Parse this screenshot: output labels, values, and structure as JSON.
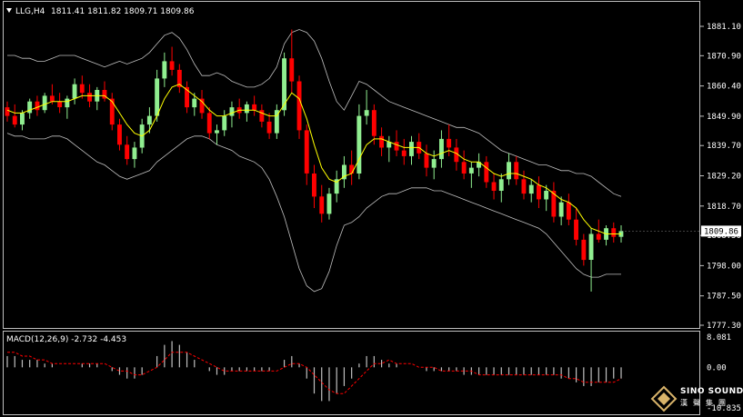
{
  "header": {
    "symbol": "LLG,H4",
    "ohlc": "1811.41 1811.82 1809.71 1809.86"
  },
  "macd_header": "MACD(12,26,9) -2.732 -4.453",
  "colors": {
    "background": "#000000",
    "bull": "#90ee90",
    "bear": "#ff0000",
    "ma": "#ffff00",
    "bands": "#c0c0c0",
    "signal": "#ff0000",
    "hist": "#c0c0c0"
  },
  "watermark": {
    "name": "SINO SOUND",
    "sub": "漢聲集團"
  },
  "chart_data": [
    {
      "type": "candlestick",
      "title": "",
      "price_axis": {
        "ticks": [
          "1881.10",
          "1870.90",
          "1860.40",
          "1849.90",
          "1839.70",
          "1829.20",
          "1818.70",
          "1808.50",
          "1798.00",
          "1787.50",
          "1777.30"
        ],
        "range": [
          1777.3,
          1881.1
        ]
      },
      "current_price_label": "1809.86",
      "candles": [
        [
          1853,
          1855,
          1848,
          1850
        ],
        [
          1850,
          1854,
          1846,
          1847
        ],
        [
          1847,
          1852,
          1845,
          1851
        ],
        [
          1851,
          1856,
          1849,
          1855
        ],
        [
          1855,
          1857,
          1850,
          1852
        ],
        [
          1852,
          1858,
          1851,
          1857
        ],
        [
          1857,
          1861,
          1854,
          1855
        ],
        [
          1855,
          1858,
          1851,
          1853
        ],
        [
          1853,
          1857,
          1849,
          1856
        ],
        [
          1856,
          1863,
          1854,
          1861
        ],
        [
          1861,
          1864,
          1856,
          1858
        ],
        [
          1858,
          1861,
          1853,
          1855
        ],
        [
          1855,
          1860,
          1852,
          1859
        ],
        [
          1859,
          1862,
          1855,
          1856
        ],
        [
          1856,
          1858,
          1845,
          1847
        ],
        [
          1847,
          1849,
          1838,
          1840
        ],
        [
          1840,
          1843,
          1833,
          1835
        ],
        [
          1835,
          1841,
          1832,
          1839
        ],
        [
          1839,
          1849,
          1837,
          1847
        ],
        [
          1847,
          1853,
          1844,
          1850
        ],
        [
          1850,
          1866,
          1848,
          1863
        ],
        [
          1863,
          1872,
          1860,
          1869
        ],
        [
          1869,
          1874,
          1864,
          1866
        ],
        [
          1866,
          1868,
          1858,
          1860
        ],
        [
          1860,
          1862,
          1851,
          1853
        ],
        [
          1853,
          1858,
          1850,
          1856
        ],
        [
          1856,
          1859,
          1849,
          1851
        ],
        [
          1851,
          1853,
          1842,
          1844
        ],
        [
          1844,
          1847,
          1840,
          1845
        ],
        [
          1845,
          1852,
          1843,
          1850
        ],
        [
          1850,
          1855,
          1846,
          1853
        ],
        [
          1853,
          1856,
          1849,
          1851
        ],
        [
          1851,
          1855,
          1848,
          1854
        ],
        [
          1854,
          1857,
          1850,
          1852
        ],
        [
          1852,
          1854,
          1846,
          1848
        ],
        [
          1848,
          1851,
          1842,
          1844
        ],
        [
          1844,
          1854,
          1842,
          1852
        ],
        [
          1852,
          1872,
          1850,
          1870
        ],
        [
          1870,
          1880,
          1858,
          1862
        ],
        [
          1862,
          1864,
          1842,
          1845
        ],
        [
          1845,
          1847,
          1826,
          1830
        ],
        [
          1830,
          1833,
          1818,
          1822
        ],
        [
          1822,
          1826,
          1813,
          1816
        ],
        [
          1816,
          1825,
          1814,
          1823
        ],
        [
          1823,
          1831,
          1820,
          1828
        ],
        [
          1828,
          1836,
          1825,
          1833
        ],
        [
          1833,
          1838,
          1826,
          1830
        ],
        [
          1830,
          1854,
          1828,
          1850
        ],
        [
          1850,
          1859,
          1847,
          1852
        ],
        [
          1852,
          1854,
          1840,
          1843
        ],
        [
          1843,
          1846,
          1836,
          1839
        ],
        [
          1839,
          1843,
          1834,
          1841
        ],
        [
          1841,
          1845,
          1836,
          1838
        ],
        [
          1838,
          1842,
          1833,
          1836
        ],
        [
          1836,
          1843,
          1833,
          1841
        ],
        [
          1841,
          1844,
          1835,
          1837
        ],
        [
          1837,
          1840,
          1829,
          1832
        ],
        [
          1832,
          1838,
          1828,
          1835
        ],
        [
          1835,
          1845,
          1832,
          1842
        ],
        [
          1842,
          1847,
          1836,
          1839
        ],
        [
          1839,
          1842,
          1831,
          1834
        ],
        [
          1834,
          1838,
          1828,
          1830
        ],
        [
          1830,
          1834,
          1825,
          1832
        ],
        [
          1832,
          1837,
          1829,
          1834
        ],
        [
          1834,
          1836,
          1825,
          1827
        ],
        [
          1827,
          1830,
          1821,
          1824
        ],
        [
          1824,
          1830,
          1820,
          1828
        ],
        [
          1828,
          1837,
          1826,
          1834
        ],
        [
          1834,
          1836,
          1826,
          1828
        ],
        [
          1828,
          1831,
          1821,
          1823
        ],
        [
          1823,
          1828,
          1820,
          1826
        ],
        [
          1826,
          1829,
          1818,
          1821
        ],
        [
          1821,
          1826,
          1817,
          1824
        ],
        [
          1824,
          1827,
          1813,
          1815
        ],
        [
          1815,
          1822,
          1812,
          1820
        ],
        [
          1820,
          1823,
          1812,
          1814
        ],
        [
          1814,
          1818,
          1805,
          1807
        ],
        [
          1807,
          1809,
          1798,
          1800
        ],
        [
          1800,
          1811,
          1789,
          1809
        ],
        [
          1809,
          1814,
          1806,
          1807
        ],
        [
          1807,
          1812,
          1805,
          1811
        ],
        [
          1811,
          1813,
          1806,
          1808
        ],
        [
          1808,
          1812,
          1806,
          1810
        ]
      ],
      "moving_average": [
        1852,
        1851,
        1851,
        1852,
        1853,
        1854,
        1855,
        1855,
        1855,
        1856,
        1857,
        1857,
        1857,
        1857,
        1855,
        1851,
        1847,
        1844,
        1843,
        1845,
        1850,
        1856,
        1860,
        1861,
        1859,
        1857,
        1855,
        1852,
        1850,
        1850,
        1851,
        1852,
        1852,
        1852,
        1851,
        1850,
        1850,
        1854,
        1858,
        1856,
        1849,
        1840,
        1832,
        1828,
        1827,
        1829,
        1830,
        1835,
        1840,
        1842,
        1842,
        1841,
        1840,
        1839,
        1839,
        1839,
        1837,
        1836,
        1837,
        1838,
        1837,
        1835,
        1834,
        1834,
        1832,
        1830,
        1829,
        1830,
        1830,
        1829,
        1828,
        1826,
        1825,
        1823,
        1821,
        1820,
        1818,
        1814,
        1811,
        1810,
        1809,
        1809,
        1809
      ],
      "bollinger_upper": [
        1871,
        1871,
        1870,
        1870,
        1869,
        1869,
        1870,
        1871,
        1871,
        1871,
        1870,
        1869,
        1868,
        1867,
        1868,
        1869,
        1868,
        1869,
        1870,
        1872,
        1875,
        1878,
        1879,
        1877,
        1873,
        1868,
        1864,
        1864,
        1865,
        1864,
        1862,
        1861,
        1860,
        1860,
        1861,
        1863,
        1867,
        1875,
        1879,
        1880,
        1879,
        1876,
        1870,
        1862,
        1855,
        1852,
        1857,
        1862,
        1861,
        1859,
        1857,
        1855,
        1854,
        1853,
        1852,
        1851,
        1850,
        1849,
        1848,
        1847,
        1846,
        1846,
        1845,
        1844,
        1842,
        1840,
        1838,
        1837,
        1836,
        1835,
        1834,
        1833,
        1833,
        1832,
        1831,
        1831,
        1830,
        1830,
        1829,
        1827,
        1825,
        1823,
        1822
      ],
      "bollinger_lower": [
        1844,
        1843,
        1843,
        1842,
        1842,
        1842,
        1843,
        1843,
        1842,
        1840,
        1838,
        1836,
        1834,
        1833,
        1831,
        1829,
        1828,
        1829,
        1830,
        1831,
        1834,
        1836,
        1838,
        1840,
        1842,
        1843,
        1843,
        1842,
        1840,
        1839,
        1838,
        1836,
        1835,
        1834,
        1832,
        1828,
        1822,
        1815,
        1806,
        1797,
        1791,
        1789,
        1790,
        1796,
        1805,
        1812,
        1813,
        1815,
        1818,
        1820,
        1822,
        1823,
        1823,
        1824,
        1825,
        1825,
        1825,
        1824,
        1824,
        1823,
        1822,
        1821,
        1820,
        1819,
        1818,
        1817,
        1816,
        1815,
        1814,
        1813,
        1812,
        1811,
        1809,
        1806,
        1803,
        1800,
        1797,
        1795,
        1794,
        1794,
        1795,
        1795,
        1795
      ],
      "macd_axis": {
        "ticks": [
          "8.081",
          "0.00",
          "-10.835"
        ],
        "range": [
          -10.835,
          8.081
        ]
      },
      "macd_hist": [
        3,
        3,
        2,
        2,
        2,
        1,
        1,
        0,
        0,
        0,
        1,
        1,
        1,
        0,
        -1,
        -2,
        -3,
        -3,
        -2,
        0,
        3,
        6,
        7,
        6,
        4,
        2,
        0,
        -1,
        -2,
        -2,
        -1,
        -1,
        -1,
        -1,
        -1,
        -1,
        0,
        2,
        3,
        1,
        -3,
        -7,
        -9,
        -9,
        -7,
        -5,
        -3,
        1,
        3,
        3,
        2,
        1,
        1,
        0,
        0,
        0,
        -1,
        -1,
        -1,
        -1,
        -1,
        -2,
        -2,
        -2,
        -2,
        -2,
        -2,
        -2,
        -2,
        -2,
        -2,
        -2,
        -2,
        -2,
        -3,
        -3,
        -4,
        -5,
        -5,
        -4,
        -4,
        -3,
        -3
      ],
      "macd_signal": [
        4,
        4,
        3,
        3,
        2,
        2,
        1,
        1,
        1,
        1,
        1,
        1,
        1,
        1,
        0,
        -1,
        -1,
        -2,
        -2,
        -1,
        0,
        2,
        4,
        4,
        4,
        3,
        2,
        1,
        0,
        -1,
        -1,
        -1,
        -1,
        -1,
        -1,
        -1,
        -1,
        0,
        1,
        1,
        0,
        -2,
        -4,
        -6,
        -7,
        -7,
        -5,
        -3,
        -1,
        1,
        1,
        2,
        1,
        1,
        1,
        0,
        0,
        0,
        -1,
        -1,
        -1,
        -1,
        -1,
        -2,
        -2,
        -2,
        -2,
        -2,
        -2,
        -2,
        -2,
        -2,
        -2,
        -2,
        -2,
        -3,
        -3,
        -4,
        -4,
        -4,
        -4,
        -4,
        -3
      ]
    }
  ]
}
